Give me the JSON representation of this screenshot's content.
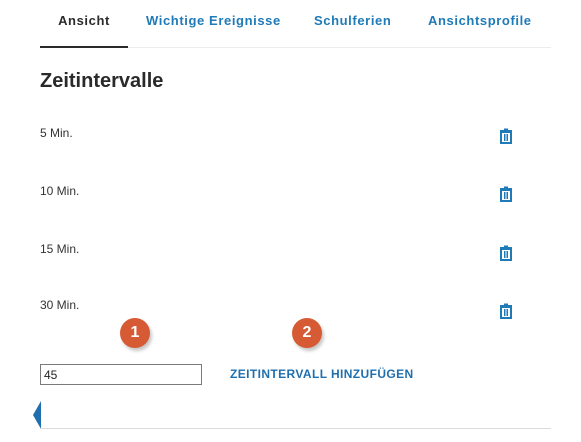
{
  "tabs": [
    {
      "label": "Ansicht",
      "active": true
    },
    {
      "label": "Wichtige Ereignisse",
      "active": false
    },
    {
      "label": "Schulferien",
      "active": false
    },
    {
      "label": "Ansichtsprofile",
      "active": false
    }
  ],
  "section": {
    "title": "Zeitintervalle"
  },
  "intervals": [
    {
      "label": "5 Min."
    },
    {
      "label": "10 Min."
    },
    {
      "label": "15 Min."
    },
    {
      "label": "30 Min."
    }
  ],
  "delete_icon": "trash-icon",
  "markers": [
    "1",
    "2"
  ],
  "form": {
    "input_value": "45",
    "add_label": "ZEITINTERVALL HINZUFÜGEN"
  },
  "colors": {
    "accent": "#1f7ab8",
    "marker": "#d65a33",
    "active_tab": "#2b2b2b"
  }
}
